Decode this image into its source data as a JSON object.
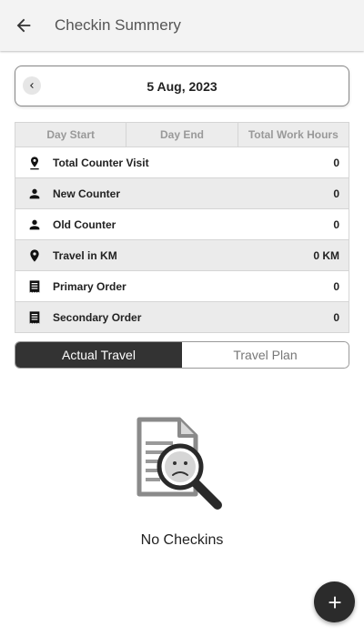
{
  "appbar": {
    "title": "Checkin Summery",
    "back_icon": "arrow-left-icon"
  },
  "date_selector": {
    "date": "5 Aug, 2023",
    "prev_icon": "chevron-left-icon"
  },
  "summary": {
    "columns": [
      "Day Start",
      "Day End",
      "Total Work Hours"
    ],
    "rows": [
      {
        "icon": "map-pin-icon",
        "label": "Total Counter Visit",
        "value": "0"
      },
      {
        "icon": "person-icon",
        "label": "New Counter",
        "value": "0"
      },
      {
        "icon": "person-icon",
        "label": "Old Counter",
        "value": "0"
      },
      {
        "icon": "location-icon",
        "label": "Travel in KM",
        "value": "0 KM"
      },
      {
        "icon": "receipt-icon",
        "label": "Primary Order",
        "value": "0"
      },
      {
        "icon": "receipt-icon",
        "label": "Secondary Order",
        "value": "0"
      }
    ]
  },
  "tabs": [
    {
      "label": "Actual Travel",
      "active": true
    },
    {
      "label": "Travel Plan",
      "active": false
    }
  ],
  "empty_state": {
    "message": "No Checkins",
    "icon": "document-search-icon"
  },
  "fab": {
    "icon": "plus-icon"
  },
  "colors": {
    "tab_active": "#333333",
    "fab": "#2b2b2b",
    "row_shade": "#ebebeb"
  }
}
